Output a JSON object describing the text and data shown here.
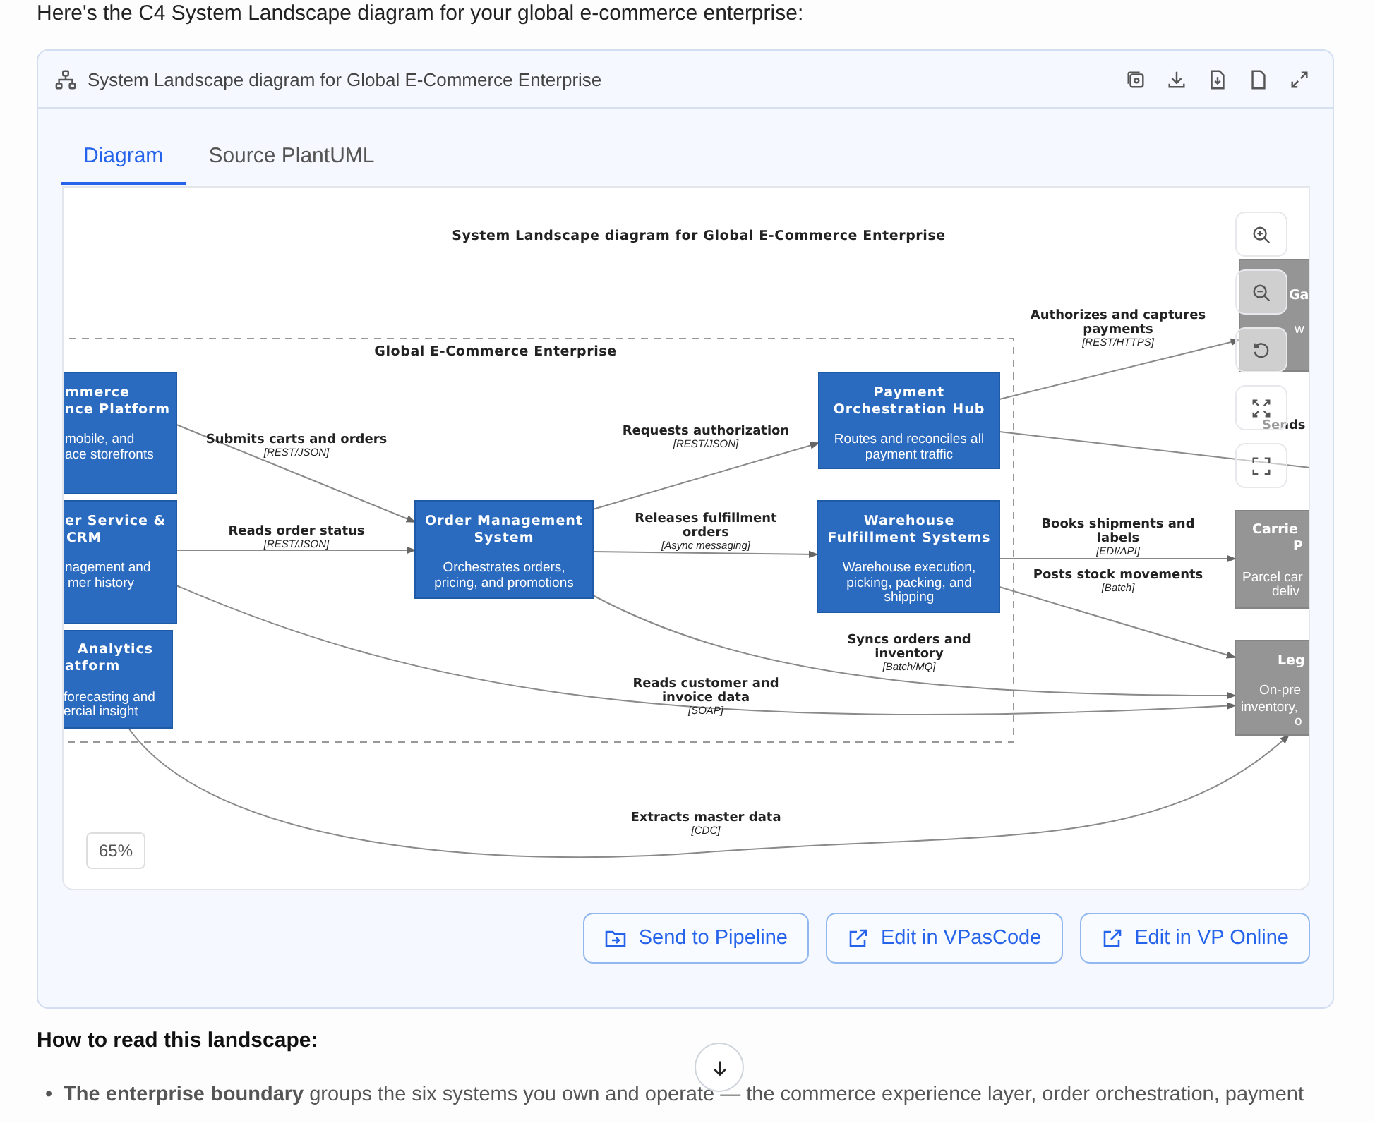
{
  "intro": "Here's the C4 System Landscape diagram for your global e-commerce enterprise:",
  "card": {
    "title": "System Landscape diagram for Global E-Commerce Enterprise"
  },
  "tabs": [
    {
      "label": "Diagram",
      "selected": true
    },
    {
      "label": "Source PlantUML",
      "selected": false
    }
  ],
  "diagram": {
    "title": "System Landscape diagram for Global E-Commerce Enterprise",
    "boundary": "Global E-Commerce Enterprise",
    "systems": [
      {
        "kind": "internal",
        "title": [
          "mmerce",
          "nce Platform"
        ],
        "description": [
          "mobile, and",
          "ace storefronts"
        ]
      },
      {
        "kind": "internal",
        "title": [
          "er Service &",
          "CRM"
        ],
        "description": [
          "nagement and",
          "mer history"
        ]
      },
      {
        "kind": "internal",
        "title": [
          "Analytics",
          "atform"
        ],
        "description": [
          "forecasting and",
          "ercial insight"
        ]
      },
      {
        "kind": "internal",
        "title": [
          "Order Management",
          "System"
        ],
        "description": [
          "Orchestrates orders,",
          "pricing, and promotions"
        ]
      },
      {
        "kind": "internal",
        "title": [
          "Payment",
          "Orchestration Hub"
        ],
        "description": [
          "Routes and reconciles all",
          "payment traffic"
        ]
      },
      {
        "kind": "internal",
        "title": [
          "Warehouse",
          "Fulfillment Systems"
        ],
        "description": [
          "Warehouse execution,",
          "picking, packing, and",
          "shipping"
        ]
      },
      {
        "kind": "external",
        "title": [
          "Ga"
        ],
        "description": [
          "w"
        ]
      },
      {
        "kind": "external",
        "title": [
          "Carrie",
          "P"
        ],
        "description": [
          "Parcel car",
          "deliv"
        ]
      },
      {
        "kind": "external",
        "title": [
          "Leg"
        ],
        "description": [
          "On-pre",
          "inventory,",
          "o"
        ]
      }
    ],
    "relationships": [
      {
        "label": [
          "Submits carts and orders"
        ],
        "technology": "[REST/JSON]"
      },
      {
        "label": [
          "Reads order status"
        ],
        "technology": "[REST/JSON]"
      },
      {
        "label": [
          "Requests authorization"
        ],
        "technology": "[REST/JSON]"
      },
      {
        "label": [
          "Releases fulfillment",
          "orders"
        ],
        "technology": "[Async messaging]"
      },
      {
        "label": [
          "Authorizes and captures",
          "payments"
        ],
        "technology": "[REST/HTTPS]"
      },
      {
        "label": [
          "Sends"
        ]
      },
      {
        "label": [
          "Books shipments and",
          "labels"
        ],
        "technology": "[EDI/API]"
      },
      {
        "label": [
          "Posts stock movements"
        ],
        "technology": "[Batch]"
      },
      {
        "label": [
          "Syncs orders and",
          "inventory"
        ],
        "technology": "[Batch/MQ]"
      },
      {
        "label": [
          "Reads customer and",
          "invoice data"
        ],
        "technology": "[SOAP]"
      },
      {
        "label": [
          "Extracts master data"
        ],
        "technology": "[CDC]"
      }
    ],
    "zoom_level": "65%"
  },
  "actions": [
    "Send to Pipeline",
    "Edit in VPasCode",
    "Edit in VP Online"
  ],
  "section_heading": "How to read this landscape:",
  "bullets": [
    {
      "marker": "•",
      "text": "**The enterprise boundary** groups the six systems you own and operate — the commerce experience layer, order orchestration, payment"
    }
  ]
}
